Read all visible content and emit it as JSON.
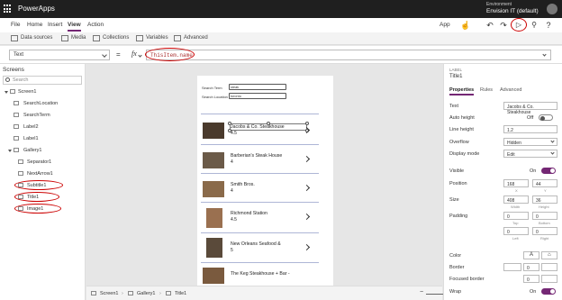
{
  "titlebar": {
    "app_name": "PowerApps",
    "env_label": "Environment",
    "env_name": "Envision IT (default)"
  },
  "menu": {
    "items": [
      "File",
      "Home",
      "Insert",
      "View",
      "Action"
    ],
    "active": "View",
    "app_label": "App"
  },
  "ribbon": {
    "items": [
      "Data sources",
      "Media",
      "Collections",
      "Variables",
      "Advanced"
    ]
  },
  "formula": {
    "property": "Text",
    "equals": "=",
    "fx": "fx",
    "expression": "ThisItem.name"
  },
  "left_panel": {
    "header": "Screens",
    "search_placeholder": "Search",
    "tree": [
      "Screen1",
      "SearchLocation",
      "SearchTerm",
      "Label2",
      "Label1",
      "Gallery1",
      "Separator1",
      "NextArrow1",
      "Subtitle1",
      "Title1",
      "Image1"
    ]
  },
  "app_preview": {
    "search_term_label": "Search Term",
    "search_term_value": "steak",
    "search_location_label": "Search Location",
    "search_location_value": "toronto",
    "items": [
      {
        "title": "Jacobs & Co. Steakhouse",
        "rating": "4.5"
      },
      {
        "title": "Barberian's Steak House",
        "rating": "4"
      },
      {
        "title": "Smith Bros.",
        "rating": "4"
      },
      {
        "title": "Richmond Station",
        "rating": "4.5"
      },
      {
        "title": "New Orleans Seafood &",
        "rating": "5"
      },
      {
        "title": "The Keg Steakhouse + Bar -",
        "rating": ""
      }
    ],
    "image_colors": [
      "#4a3a2c",
      "#6b5a48",
      "#8a6a4a",
      "#9a7050",
      "#5a4a3a",
      "#7a5a3e"
    ]
  },
  "bottom_bar": {
    "crumbs": [
      "Screen1",
      "Gallery1",
      "Title1"
    ],
    "zoom_minus": "−",
    "zoom_plus": "+",
    "zoom_value": "50",
    "zoom_unit": "%"
  },
  "right_panel": {
    "type_label": "LABEL",
    "control_name": "Title1",
    "tabs": [
      "Properties",
      "Rules",
      "Advanced"
    ],
    "active_tab": "Properties",
    "text_label": "Text",
    "text_value": "Jacobs & Co. Steakhouse",
    "auto_height_label": "Auto height",
    "auto_height_value": "Off",
    "line_height_label": "Line height",
    "line_height_value": "1.2",
    "overflow_label": "Overflow",
    "overflow_value": "Hidden",
    "display_mode_label": "Display mode",
    "display_mode_value": "Edit",
    "visible_label": "Visible",
    "visible_value": "On",
    "position_label": "Position",
    "position_x": "168",
    "position_y": "44",
    "x_label": "X",
    "y_label": "Y",
    "size_label": "Size",
    "size_w": "408",
    "size_h": "36",
    "width_label": "Width",
    "height_label": "Height",
    "padding_label": "Padding",
    "padding_top": "0",
    "padding_bottom": "0",
    "padding_left": "0",
    "padding_right": "0",
    "top_label": "Top",
    "bottom_label": "Bottom",
    "left_label": "Left",
    "right_label": "Right",
    "color_label": "Color",
    "border_label": "Border",
    "border_value": "0",
    "focused_border_label": "Focused border",
    "focused_border_value": "0",
    "wrap_label": "Wrap",
    "wrap_value": "On",
    "accent": "#742774"
  }
}
